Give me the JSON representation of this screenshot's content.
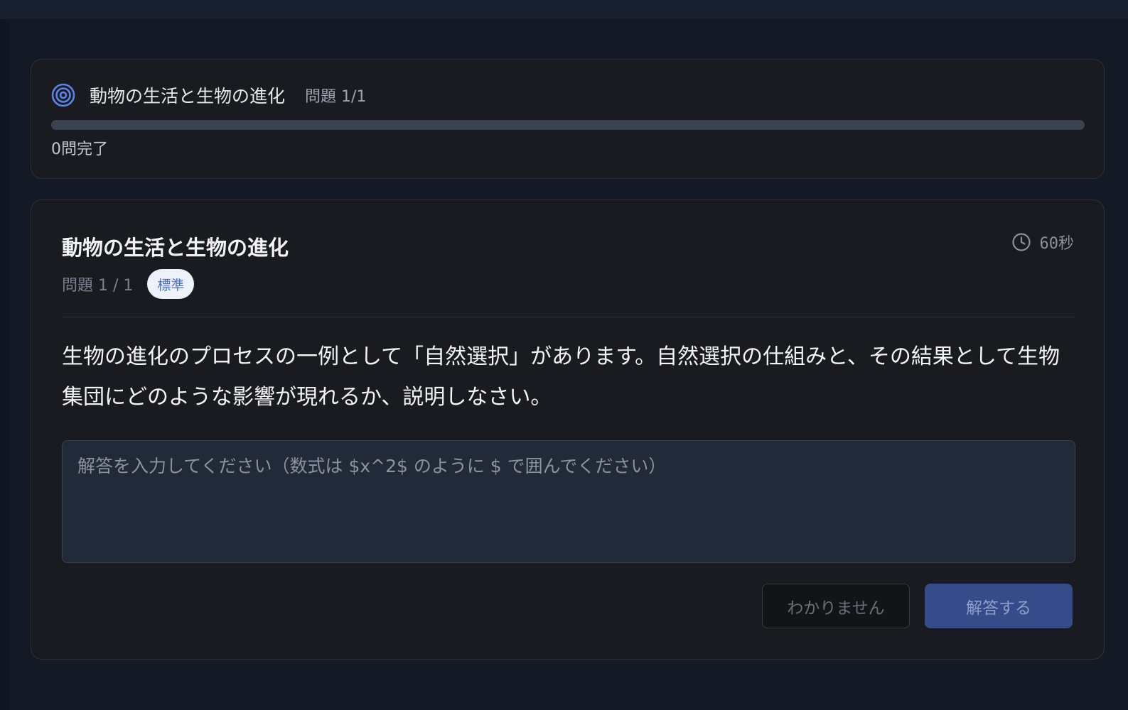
{
  "progress": {
    "title": "動物の生活と生物の進化",
    "question_count": "問題 1/1",
    "status": "0問完了",
    "fraction_complete": 0,
    "icon": "target-icon"
  },
  "question": {
    "title": "動物の生活と生物の進化",
    "number": "問題 1 / 1",
    "difficulty": "標準",
    "timer": "60秒",
    "timer_icon": "clock-icon",
    "text": "生物の進化のプロセスの一例として「自然選択」があります。自然選択の仕組みと、その結果として生物集団にどのような影響が現れるか、説明しなさい。",
    "answer": {
      "value": "",
      "placeholder": "解答を入力してください（数式は $x^2$ のように $ で囲んでください）"
    },
    "buttons": {
      "unknown": "わかりません",
      "submit": "解答する"
    }
  },
  "colors": {
    "accent": "#4a6fcf",
    "submit_bg": "#354b8a",
    "card_bg": "#191b21",
    "page_bg": "#131a26"
  }
}
